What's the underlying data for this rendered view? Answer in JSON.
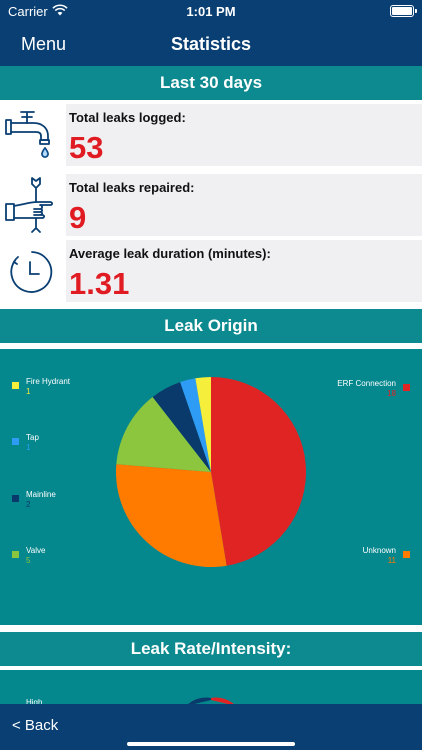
{
  "status": {
    "carrier": "Carrier",
    "time": "1:01 PM"
  },
  "nav": {
    "menu_label": "Menu",
    "title": "Statistics"
  },
  "summary": {
    "period": "Last 30 days",
    "total_logged_label": "Total leaks logged:",
    "total_logged_value": "53",
    "total_repaired_label": "Total leaks repaired:",
    "total_repaired_value": "9",
    "avg_duration_label": "Average leak duration (minutes):",
    "avg_duration_value": "1.31"
  },
  "sections": {
    "leak_origin": "Leak Origin",
    "leak_rate": "Leak Rate/Intensity:"
  },
  "chart_data": [
    {
      "type": "pie",
      "title": "Leak Origin",
      "series": [
        {
          "name": "ERF Connection",
          "value": 18,
          "value_label": "18",
          "color": "#e02424"
        },
        {
          "name": "Unknown",
          "value": 11,
          "value_label": "11",
          "color": "#ff7b00"
        },
        {
          "name": "Valve",
          "value": 5,
          "value_label": "5",
          "color": "#8cc63e"
        },
        {
          "name": "Mainline",
          "value": 2,
          "value_label": "2",
          "color": "#0a3a6b"
        },
        {
          "name": "Tap",
          "value": 1,
          "value_label": "1",
          "color": "#2e9cf4"
        },
        {
          "name": "Fire Hydrant",
          "value": 1,
          "value_label": "1",
          "color": "#f5ee3b"
        }
      ],
      "legend_placement": "left-and-right"
    },
    {
      "type": "pie",
      "title": "Leak Rate/Intensity:",
      "series": [
        {
          "name": "High"
        }
      ]
    }
  ],
  "bottom": {
    "back_label": "< Back"
  },
  "colors": {
    "nav": "#0a3f73",
    "teal": "#0d8a8f",
    "chart_bg": "#04878d",
    "value_red": "#e01b22"
  }
}
